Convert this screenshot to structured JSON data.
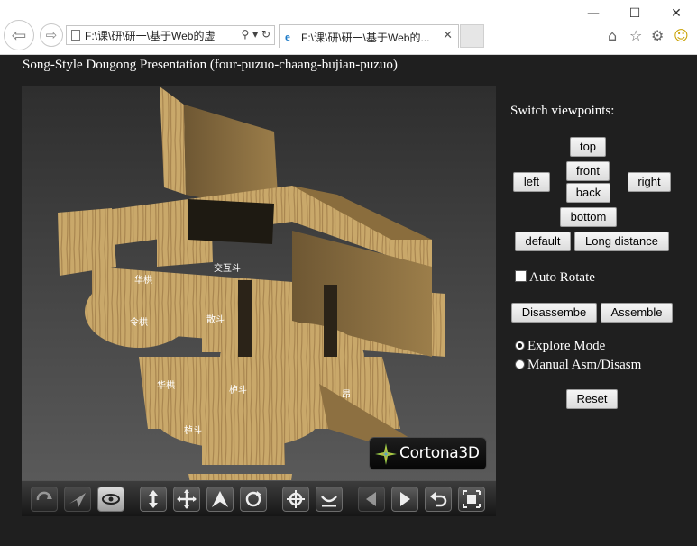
{
  "window": {
    "minimize_icon": "minimize-icon",
    "maximize_icon": "maximize-icon",
    "close_icon": "close-icon"
  },
  "browser": {
    "address_url": "F:\\课\\研\\研一\\基于Web的虚",
    "address_tools": "⚲ ▾ ↻",
    "tab_title": "F:\\课\\研\\研一\\基于Web的...",
    "tab_close": "✕",
    "toolbar_icons": [
      "home-icon",
      "favorites-star-icon",
      "settings-gear-icon",
      "feedback-smiley-icon"
    ]
  },
  "page": {
    "title": "Song-Style Dougong Presentation (four-puzuo-chaang-bujian-puzuo)"
  },
  "viewer": {
    "brand": "Cortona3D",
    "wood_color": "#c9a86a",
    "toolbar_buttons": [
      "orbit-icon",
      "fly-icon",
      "study-eye-icon",
      "pan-vertical-icon",
      "pan-icon",
      "walk-icon",
      "rotate-icon",
      "center-target-icon",
      "align-icon",
      "previous-view-icon",
      "next-view-icon",
      "undo-view-icon",
      "fit-view-icon"
    ]
  },
  "panel": {
    "heading": "Switch viewpoints:",
    "viewpoints": {
      "top": "top",
      "left": "left",
      "front": "front",
      "right": "right",
      "back": "back",
      "bottom": "bottom",
      "default": "default",
      "long_distance": "Long distance"
    },
    "auto_rotate_label": "Auto Rotate",
    "auto_rotate_checked": false,
    "disassemble_label": "Disassembe",
    "assemble_label": "Assemble",
    "mode_explore_label": "Explore Mode",
    "mode_manual_label": "Manual Asm/Disasm",
    "selected_mode": "explore",
    "reset_label": "Reset"
  }
}
